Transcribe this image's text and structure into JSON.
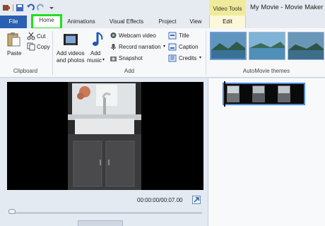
{
  "window": {
    "title": "My Movie - Movie Maker",
    "contextual_tab_group": "Video Tools"
  },
  "tabs": [
    {
      "label": "File"
    },
    {
      "label": "Home"
    },
    {
      "label": "Animations"
    },
    {
      "label": "Visual Effects"
    },
    {
      "label": "Project"
    },
    {
      "label": "View"
    },
    {
      "label": "Edit"
    }
  ],
  "ribbon": {
    "clipboard": {
      "paste": "Paste",
      "cut": "Cut",
      "copy": "Copy",
      "group_label": "Clipboard"
    },
    "add": {
      "add_videos_line1": "Add videos",
      "add_videos_line2": "and photos",
      "add_music_line1": "Add",
      "add_music_line2": "music",
      "webcam_video": "Webcam video",
      "record_narration": "Record narration",
      "snapshot": "Snapshot",
      "title": "Title",
      "caption": "Caption",
      "credits": "Credits",
      "group_label": "Add"
    },
    "automovie": {
      "group_label": "AutoMovie themes"
    }
  },
  "preview": {
    "time": "00:00:00/00:07.00",
    "seek_progress": 0.0
  },
  "colors": {
    "file_tab": "#2b5fb1",
    "highlight": "#20e01e",
    "contextual": "#f0eb9a",
    "clip_border": "#4f89d8"
  }
}
